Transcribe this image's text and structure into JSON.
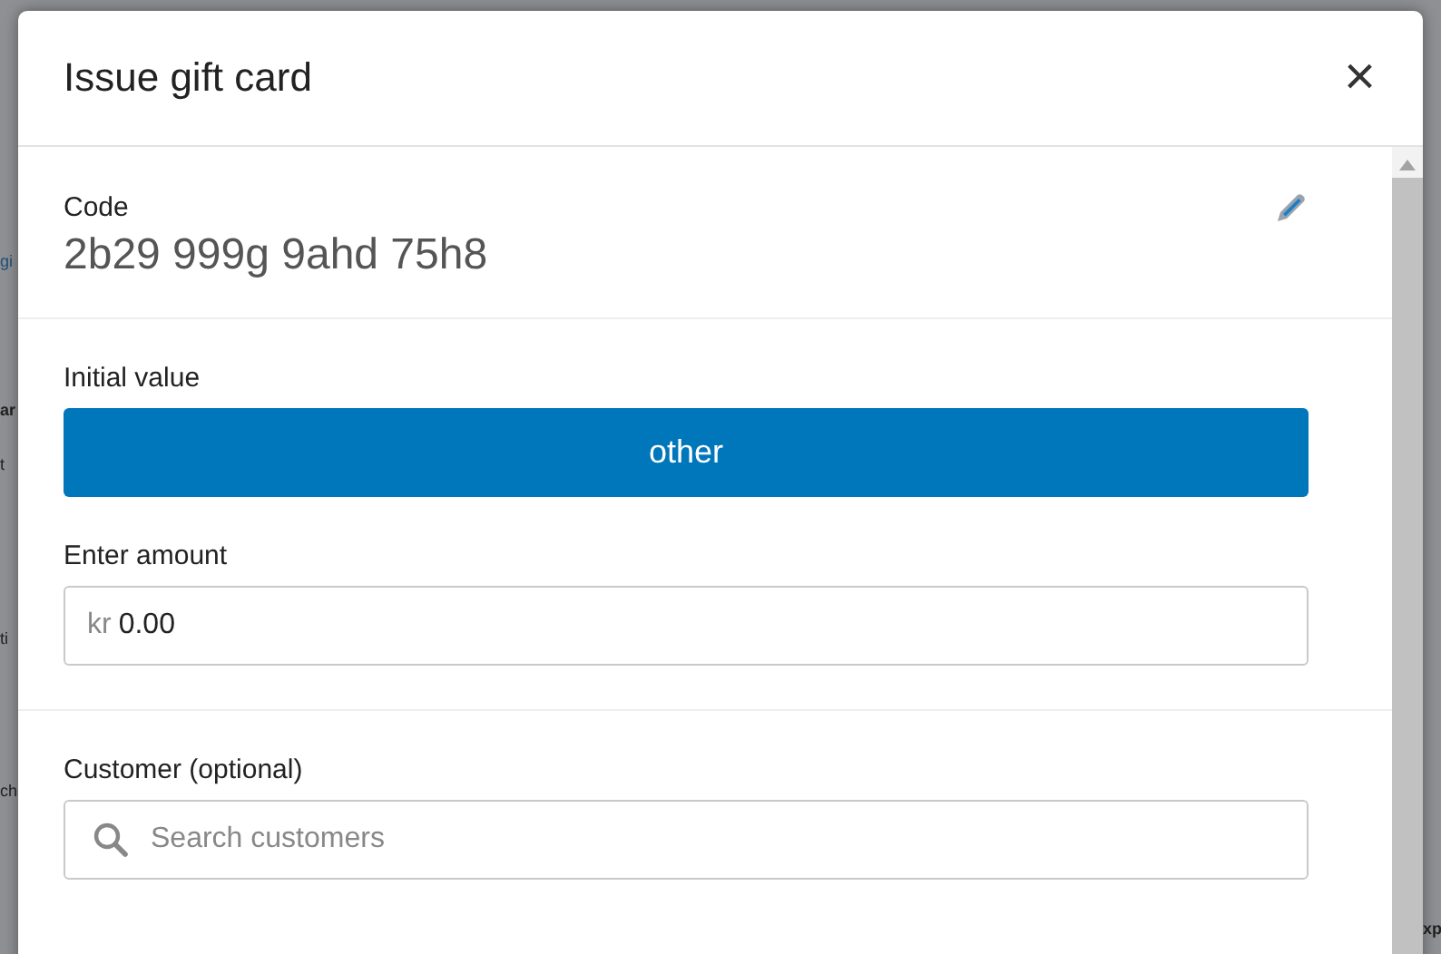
{
  "backdrop": {
    "left_fragments": [
      {
        "text": "gi",
        "kind": "link"
      },
      {
        "text": "ar",
        "kind": "bold"
      },
      {
        "text": "t",
        "kind": "plain"
      },
      {
        "text": "ti",
        "kind": "plain"
      },
      {
        "text": "ch",
        "kind": "plain"
      }
    ],
    "right_fragments": [
      {
        "text": "xp",
        "kind": "bold"
      }
    ]
  },
  "dialog": {
    "title": "Issue gift card",
    "close": "×",
    "code": {
      "label": "Code",
      "value": "2b29 999g 9ahd 75h8"
    },
    "initial_value": {
      "label": "Initial value",
      "options": [
        {
          "label": "other",
          "selected": true
        }
      ]
    },
    "amount": {
      "label": "Enter amount",
      "prefix": "kr",
      "value": "0.00"
    },
    "customer": {
      "label": "Customer (optional)",
      "placeholder": "Search customers"
    }
  }
}
